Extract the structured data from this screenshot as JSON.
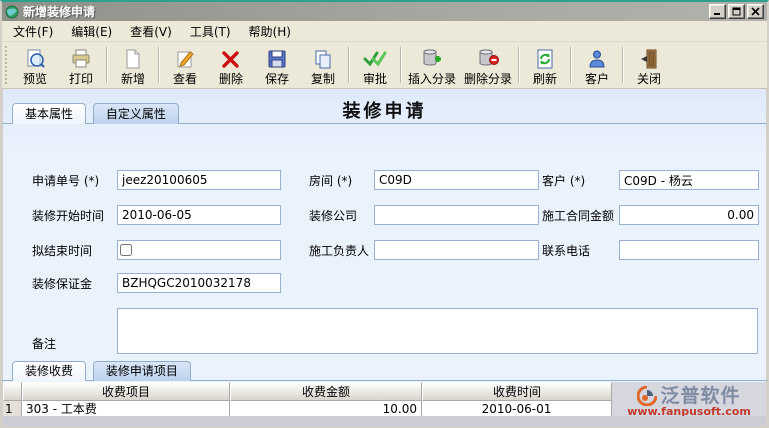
{
  "window": {
    "title": "新增装修申请"
  },
  "menubar": {
    "items": [
      {
        "label": "文件(F)"
      },
      {
        "label": "编辑(E)"
      },
      {
        "label": "查看(V)"
      },
      {
        "label": "工具(T)"
      },
      {
        "label": "帮助(H)"
      }
    ]
  },
  "toolbar": {
    "items": [
      {
        "label": "预览"
      },
      {
        "label": "打印"
      },
      {
        "label": "新增"
      },
      {
        "label": "查看"
      },
      {
        "label": "删除"
      },
      {
        "label": "保存"
      },
      {
        "label": "复制"
      },
      {
        "label": "审批"
      },
      {
        "label": "插入分录"
      },
      {
        "label": "删除分录"
      },
      {
        "label": "刷新"
      },
      {
        "label": "客户"
      },
      {
        "label": "关闭"
      }
    ]
  },
  "page": {
    "title": "装修申请"
  },
  "tabs": {
    "top": [
      {
        "label": "基本属性"
      },
      {
        "label": "自定义属性"
      }
    ],
    "bottom": [
      {
        "label": "装修收费"
      },
      {
        "label": "装修申请项目"
      }
    ]
  },
  "form": {
    "fields": {
      "application_no": {
        "label": "申请单号 (*)",
        "value": "jeez20100605"
      },
      "room": {
        "label": "房间 (*)",
        "value": "C09D"
      },
      "customer": {
        "label": "客户 (*)",
        "value": "C09D - 杨云"
      },
      "start_date": {
        "label": "装修开始时间",
        "value": "2010-06-05"
      },
      "company": {
        "label": "装修公司",
        "value": ""
      },
      "contract_amount": {
        "label": "施工合同金额",
        "value": "0.00"
      },
      "planned_end": {
        "label": "拟结束时间",
        "value": ""
      },
      "manager": {
        "label": "施工负责人",
        "value": ""
      },
      "phone": {
        "label": "联系电话",
        "value": ""
      },
      "deposit": {
        "label": "装修保证金",
        "value": "BZHQGC2010032178"
      },
      "remark": {
        "label": "备注",
        "value": ""
      }
    }
  },
  "grid": {
    "headers": [
      "收费项目",
      "收费金额",
      "收费时间"
    ],
    "rows": [
      {
        "num": "1",
        "item": "303 - 工本费",
        "amount": "10.00",
        "time": "2010-06-01"
      }
    ]
  },
  "watermark": {
    "name": "泛普软件",
    "url": "www.fanpusoft.com"
  }
}
